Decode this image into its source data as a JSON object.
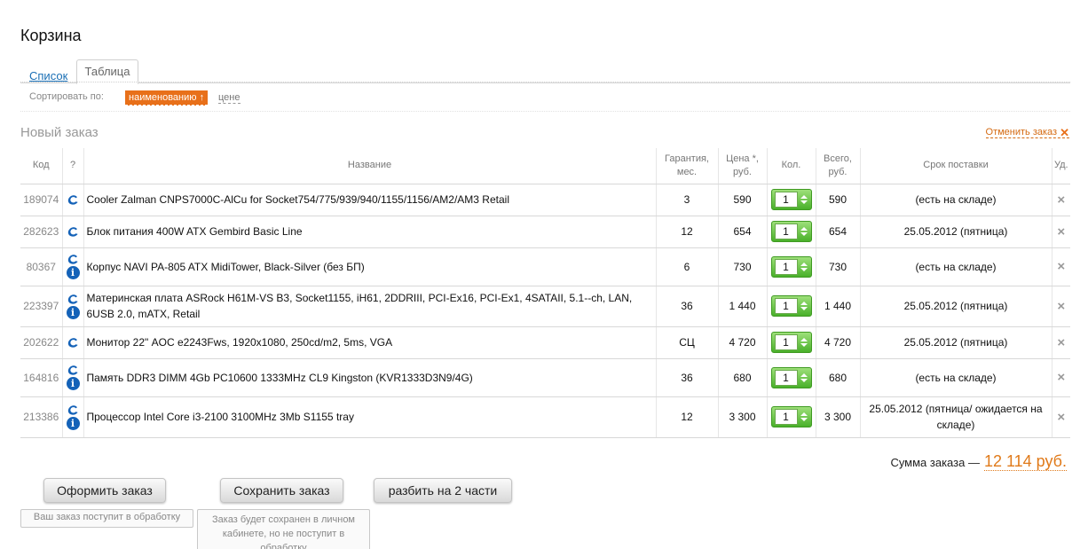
{
  "page": {
    "title": "Корзина"
  },
  "tabs": {
    "list": "Список",
    "table": "Таблица"
  },
  "sort": {
    "label": "Сортировать по:",
    "active": "наименованию ↑",
    "other": "цене"
  },
  "order": {
    "title": "Новый заказ",
    "cancel": "Отменить заказ",
    "cancel_icon": "close-icon"
  },
  "table": {
    "headers": {
      "code": "Код",
      "info": "?",
      "name": "Название",
      "warranty": "Гарантия, мес.",
      "price": "Цена *, руб.",
      "qty": "Кол.",
      "total": "Всего, руб.",
      "delivery": "Срок поставки",
      "del": "Уд."
    },
    "rows": [
      {
        "code": "189074",
        "icons": [
          "c-icon"
        ],
        "name": "Cooler Zalman CNPS7000C-AlCu for Socket754/775/939/940/1155/1156/AM2/AM3 Retail",
        "warranty": "3",
        "price": "590",
        "qty": "1",
        "total": "590",
        "delivery": "(есть на складе)"
      },
      {
        "code": "282623",
        "icons": [
          "c-icon"
        ],
        "name": "Блок питания 400W ATX Gembird Basic Line",
        "warranty": "12",
        "price": "654",
        "qty": "1",
        "total": "654",
        "delivery": "25.05.2012 (пятница)"
      },
      {
        "code": "80367",
        "icons": [
          "c-icon",
          "info-icon"
        ],
        "name": "Корпус NAVI PA-805 ATX MidiTower, Black-Silver (без БП)",
        "warranty": "6",
        "price": "730",
        "qty": "1",
        "total": "730",
        "delivery": "(есть на складе)"
      },
      {
        "code": "223397",
        "icons": [
          "c-icon",
          "info-icon"
        ],
        "name": "Материнская плата ASRock H61M-VS B3, Socket1155, iH61, 2DDRIII, PCI-Ex16, PCI-Ex1, 4SATAII, 5.1--ch, LAN, 6USB 2.0, mATX, Retail",
        "warranty": "36",
        "price": "1 440",
        "qty": "1",
        "total": "1 440",
        "delivery": "25.05.2012 (пятница)"
      },
      {
        "code": "202622",
        "icons": [
          "c-icon"
        ],
        "name": "Монитор 22\" AOC e2243Fws, 1920x1080, 250cd/m2, 5ms, VGA",
        "warranty": "СЦ",
        "price": "4 720",
        "qty": "1",
        "total": "4 720",
        "delivery": "25.05.2012 (пятница)"
      },
      {
        "code": "164816",
        "icons": [
          "c-icon",
          "info-icon"
        ],
        "name": "Память DDR3 DIMM 4Gb PC10600 1333MHz CL9 Kingston (KVR1333D3N9/4G)",
        "warranty": "36",
        "price": "680",
        "qty": "1",
        "total": "680",
        "delivery": "(есть на складе)"
      },
      {
        "code": "213386",
        "icons": [
          "c-icon",
          "info-icon"
        ],
        "name": "Процессор Intel Core i3-2100 3100MHz 3Mb S1155 tray",
        "warranty": "12",
        "price": "3 300",
        "qty": "1",
        "total": "3 300",
        "delivery": "25.05.2012 (пятница/ ожидается на складе)"
      }
    ]
  },
  "summary": {
    "label": "Сумма заказа —",
    "value": "12 114 руб."
  },
  "buttons": {
    "checkout": "Оформить заказ",
    "checkout_tip": "Ваш заказ поступит в обработку",
    "save": "Сохранить заказ",
    "save_tip": "Заказ будет сохранен в личном кабинете, но не поступит в обработку",
    "split": "разбить на 2 части"
  },
  "colors": {
    "accent": "#e8701a",
    "link": "#1a6fb5",
    "qty_green": "#49b02a",
    "info_blue": "#1462b8"
  }
}
